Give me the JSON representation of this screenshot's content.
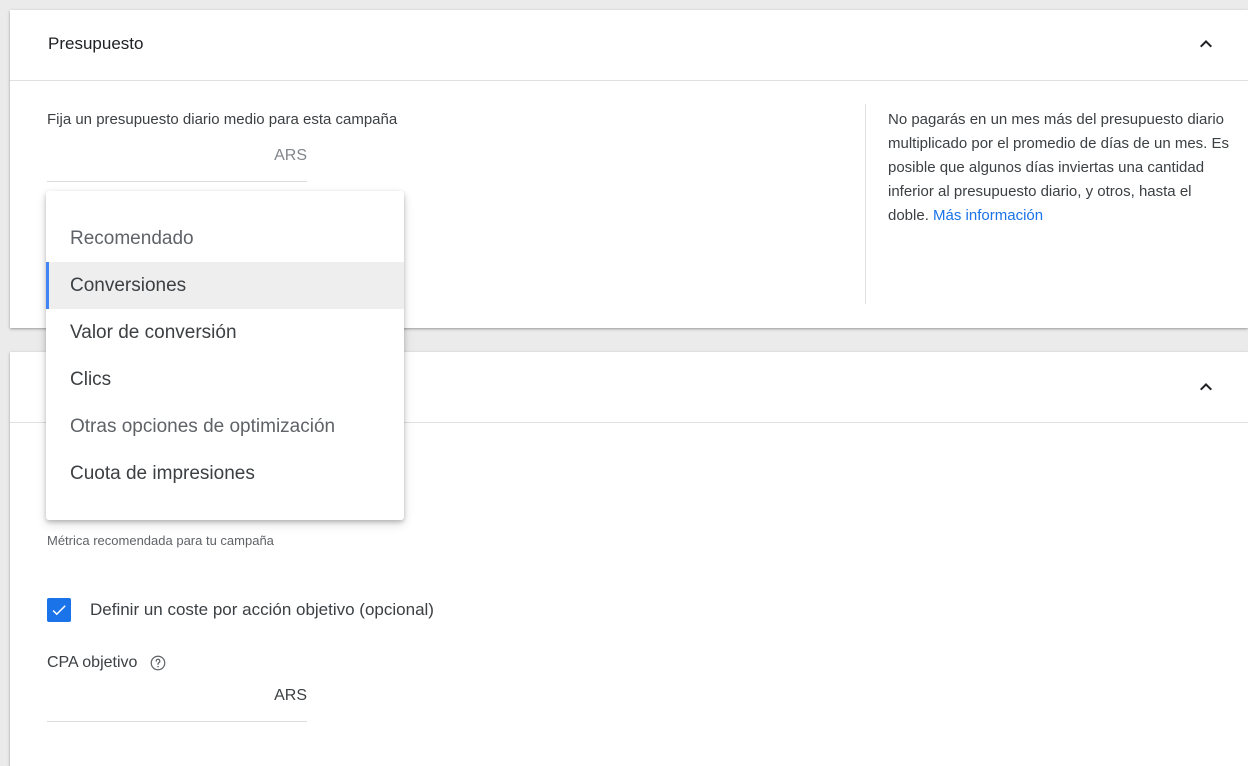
{
  "budget_card": {
    "title": "Presupuesto",
    "daily_budget_label": "Fija un presupuesto diario medio para esta campaña",
    "currency": "ARS",
    "help_text": "No pagarás en un mes más del presupuesto diario multiplicado por el promedio de días de un mes. Es posible que algunos días inviertas una cantidad inferior al presupuesto diario, y otros, hasta el doble.",
    "help_link": "Más información"
  },
  "bid_card": {
    "metric_note": "Métrica recomendada para tu campaña",
    "target_cpa_checkbox_label": "Definir un coste por acción objetivo (opcional)",
    "target_cpa_checked": true,
    "cpa_label": "CPA objetivo",
    "cpa_currency": "ARS"
  },
  "dropdown": {
    "items": [
      {
        "label": "Recomendado",
        "kind": "header"
      },
      {
        "label": "Conversiones",
        "selected": true
      },
      {
        "label": "Valor de conversión"
      },
      {
        "label": "Clics"
      },
      {
        "label": "Otras opciones de optimización"
      },
      {
        "label": "Cuota de impresiones"
      }
    ]
  },
  "colors": {
    "accent": "#1a73e8",
    "selected_bar": "#4285f4",
    "selected_bg": "#eeeeee",
    "page_bg": "#ebebeb"
  },
  "icons": {
    "collapse": "chevron-up-icon",
    "help": "help-circle-icon",
    "check": "check-icon"
  }
}
